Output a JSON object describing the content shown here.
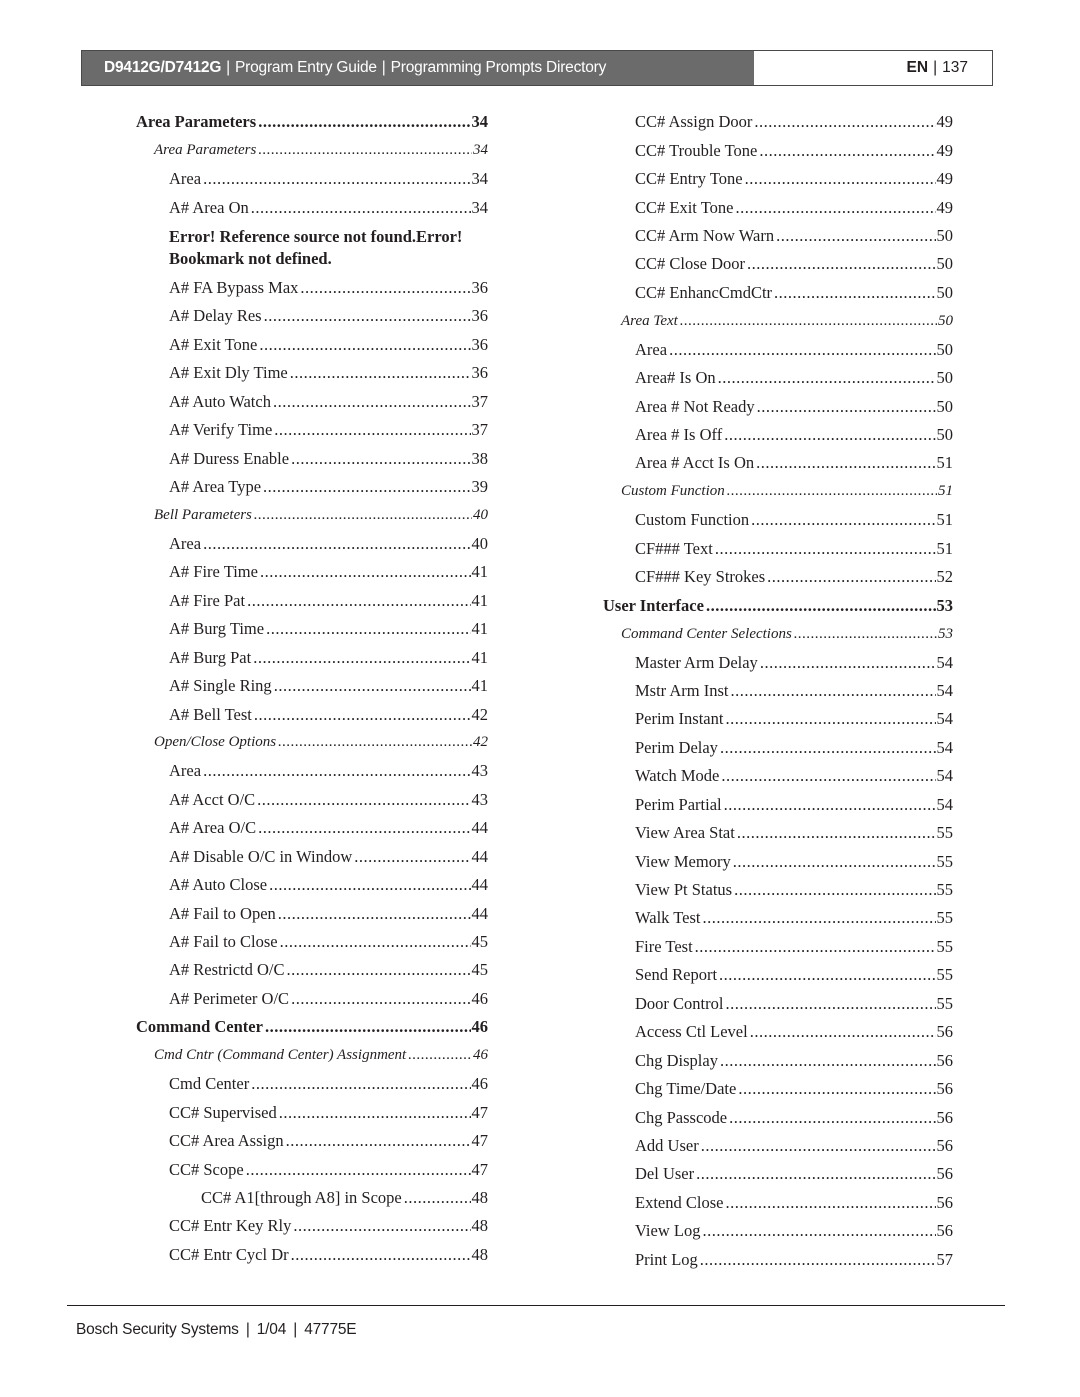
{
  "header": {
    "product": "D9412G/D7412G",
    "guide": "Program Entry Guide",
    "section": "Programming Prompts Directory",
    "language": "EN",
    "page_number": "137",
    "separator": "|"
  },
  "left_column": {
    "before_error": [
      {
        "level": 1,
        "label": "Area Parameters",
        "page": "34"
      },
      {
        "level": 2,
        "label": "Area Parameters",
        "page": "34"
      },
      {
        "level": 3,
        "label": "Area",
        "page": "34"
      },
      {
        "level": 3,
        "label": "A# Area On",
        "page": "34"
      }
    ],
    "error_text_line1": "Error! Reference source not found.Error!",
    "error_text_line2": "Bookmark not defined.",
    "after_error": [
      {
        "level": 3,
        "label": "A# FA Bypass Max",
        "page": "36"
      },
      {
        "level": 3,
        "label": "A# Delay Res",
        "page": "36"
      },
      {
        "level": 3,
        "label": "A# Exit Tone",
        "page": "36"
      },
      {
        "level": 3,
        "label": "A# Exit Dly Time",
        "page": "36"
      },
      {
        "level": 3,
        "label": "A# Auto Watch",
        "page": "37"
      },
      {
        "level": 3,
        "label": "A# Verify Time",
        "page": "37"
      },
      {
        "level": 3,
        "label": "A# Duress Enable",
        "page": "38"
      },
      {
        "level": 3,
        "label": "A# Area Type",
        "page": "39"
      },
      {
        "level": 2,
        "label": "Bell Parameters",
        "page": "40"
      },
      {
        "level": 3,
        "label": "Area",
        "page": "40"
      },
      {
        "level": 3,
        "label": "A# Fire Time",
        "page": "41"
      },
      {
        "level": 3,
        "label": "A# Fire Pat",
        "page": "41"
      },
      {
        "level": 3,
        "label": "A# Burg Time",
        "page": "41"
      },
      {
        "level": 3,
        "label": "A# Burg Pat",
        "page": "41"
      },
      {
        "level": 3,
        "label": "A# Single Ring",
        "page": "41"
      },
      {
        "level": 3,
        "label": "A# Bell Test",
        "page": "42"
      },
      {
        "level": 2,
        "label": "Open/Close Options",
        "page": "42"
      },
      {
        "level": 3,
        "label": "Area",
        "page": "43"
      },
      {
        "level": 3,
        "label": "A# Acct O/C",
        "page": "43"
      },
      {
        "level": 3,
        "label": "A# Area O/C",
        "page": "44"
      },
      {
        "level": 3,
        "label": "A# Disable O/C in Window",
        "page": "44"
      },
      {
        "level": 3,
        "label": "A# Auto Close",
        "page": "44"
      },
      {
        "level": 3,
        "label": "A# Fail to Open",
        "page": "44"
      },
      {
        "level": 3,
        "label": "A# Fail to Close",
        "page": "45"
      },
      {
        "level": 3,
        "label": "A# Restrictd O/C",
        "page": "45"
      },
      {
        "level": 3,
        "label": "A# Perimeter O/C",
        "page": "46"
      },
      {
        "level": 1,
        "label": "Command Center",
        "page": "46"
      },
      {
        "level": 2,
        "label": "Cmd Cntr (Command Center) Assignment",
        "page": "46"
      },
      {
        "level": 3,
        "label": "Cmd Center",
        "page": "46"
      },
      {
        "level": 3,
        "label": "CC# Supervised",
        "page": "47"
      },
      {
        "level": 3,
        "label": "CC# Area Assign",
        "page": "47"
      },
      {
        "level": 3,
        "label": "CC# Scope",
        "page": "47"
      },
      {
        "level": 4,
        "label": "CC# A1[through A8] in Scope",
        "page": "48"
      },
      {
        "level": 3,
        "label": "CC# Entr Key Rly",
        "page": "48"
      },
      {
        "level": 3,
        "label": "CC# Entr Cycl Dr",
        "page": "48"
      }
    ]
  },
  "right_column": {
    "entries": [
      {
        "level": 3,
        "label": "CC# Assign Door",
        "page": "49"
      },
      {
        "level": 3,
        "label": "CC# Trouble Tone",
        "page": "49"
      },
      {
        "level": 3,
        "label": "CC# Entry Tone",
        "page": "49"
      },
      {
        "level": 3,
        "label": "CC# Exit Tone",
        "page": "49"
      },
      {
        "level": 3,
        "label": "CC# Arm Now Warn",
        "page": "50"
      },
      {
        "level": 3,
        "label": "CC# Close Door",
        "page": "50"
      },
      {
        "level": 3,
        "label": "CC# EnhancCmdCtr",
        "page": "50"
      },
      {
        "level": 2,
        "label": "Area Text",
        "page": "50"
      },
      {
        "level": 3,
        "label": "Area",
        "page": "50"
      },
      {
        "level": 3,
        "label": "Area# Is On",
        "page": "50"
      },
      {
        "level": 3,
        "label": "Area # Not Ready",
        "page": "50"
      },
      {
        "level": 3,
        "label": "Area # Is Off",
        "page": "50"
      },
      {
        "level": 3,
        "label": "Area # Acct Is On",
        "page": "51"
      },
      {
        "level": 2,
        "label": "Custom Function",
        "page": "51"
      },
      {
        "level": 3,
        "label": "Custom Function",
        "page": "51"
      },
      {
        "level": 3,
        "label": "CF### Text",
        "page": "51"
      },
      {
        "level": 3,
        "label": "CF### Key Strokes",
        "page": "52"
      },
      {
        "level": 1,
        "label": "User Interface",
        "page": "53"
      },
      {
        "level": 2,
        "label": "Command Center Selections",
        "page": "53"
      },
      {
        "level": 3,
        "label": "Master Arm Delay",
        "page": "54"
      },
      {
        "level": 3,
        "label": "Mstr Arm Inst",
        "page": "54"
      },
      {
        "level": 3,
        "label": "Perim Instant",
        "page": "54"
      },
      {
        "level": 3,
        "label": "Perim Delay",
        "page": "54"
      },
      {
        "level": 3,
        "label": "Watch Mode",
        "page": "54"
      },
      {
        "level": 3,
        "label": "Perim Partial",
        "page": "54"
      },
      {
        "level": 3,
        "label": "View Area Stat",
        "page": "55"
      },
      {
        "level": 3,
        "label": "View Memory",
        "page": "55"
      },
      {
        "level": 3,
        "label": "View Pt Status",
        "page": "55"
      },
      {
        "level": 3,
        "label": "Walk Test",
        "page": "55"
      },
      {
        "level": 3,
        "label": "Fire Test",
        "page": "55"
      },
      {
        "level": 3,
        "label": "Send Report",
        "page": "55"
      },
      {
        "level": 3,
        "label": "Door Control",
        "page": "55"
      },
      {
        "level": 3,
        "label": "Access Ctl Level",
        "page": "56"
      },
      {
        "level": 3,
        "label": "Chg Display",
        "page": "56"
      },
      {
        "level": 3,
        "label": "Chg Time/Date",
        "page": "56"
      },
      {
        "level": 3,
        "label": "Chg Passcode",
        "page": "56"
      },
      {
        "level": 3,
        "label": "Add User",
        "page": "56"
      },
      {
        "level": 3,
        "label": "Del User",
        "page": "56"
      },
      {
        "level": 3,
        "label": "Extend Close",
        "page": "56"
      },
      {
        "level": 3,
        "label": "View Log",
        "page": "56"
      },
      {
        "level": 3,
        "label": "Print Log",
        "page": "57"
      }
    ]
  },
  "footer": {
    "company": "Bosch Security Systems",
    "date": "1/04",
    "doc_number": "47775E",
    "separator": "|"
  }
}
